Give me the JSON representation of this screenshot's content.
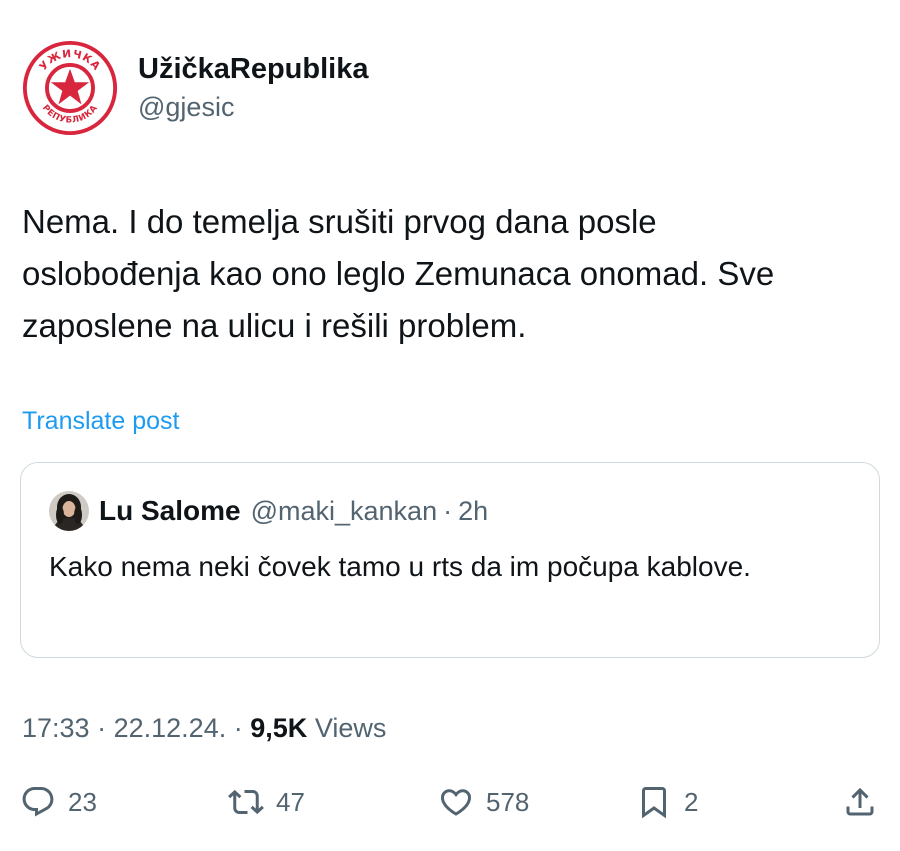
{
  "author": {
    "display_name": "UžičkaRepublika",
    "handle": "@gjesic",
    "avatar": "red-star-seal-logo",
    "avatar_text_top": "УЖИЧКА",
    "avatar_text_bottom": "РЕПУБЛИКА",
    "avatar_color": "#d7263d"
  },
  "tweet": {
    "text": "Nema. I do temelja srušiti prvog dana posle\noslobođenja kao ono leglo Zemunaca onomad. Sve\nzaposlene na ulicu i rešili problem."
  },
  "translate_label": "Translate post",
  "quoted_post": {
    "display_name": "Lu Salome",
    "handle": "@maki_kankan",
    "separator": "·",
    "time": "2h",
    "text": "Kako nema neki čovek tamo u rts da im počupa kablove."
  },
  "meta": {
    "time": "17:33",
    "dot1": "·",
    "date": "22.12.24.",
    "dot2": "·",
    "views_count": "9,5K",
    "views_label": "Views"
  },
  "actions": {
    "reply": {
      "icon": "reply-icon",
      "count": "23"
    },
    "repost": {
      "icon": "repost-icon",
      "count": "47"
    },
    "like": {
      "icon": "heart-icon",
      "count": "578"
    },
    "bookmark": {
      "icon": "bookmark-icon",
      "count": "2"
    },
    "share": {
      "icon": "share-icon"
    }
  },
  "colors": {
    "accent": "#1d9bf0",
    "text": "#0f1419",
    "secondary": "#536471",
    "border": "#cfd9de"
  }
}
